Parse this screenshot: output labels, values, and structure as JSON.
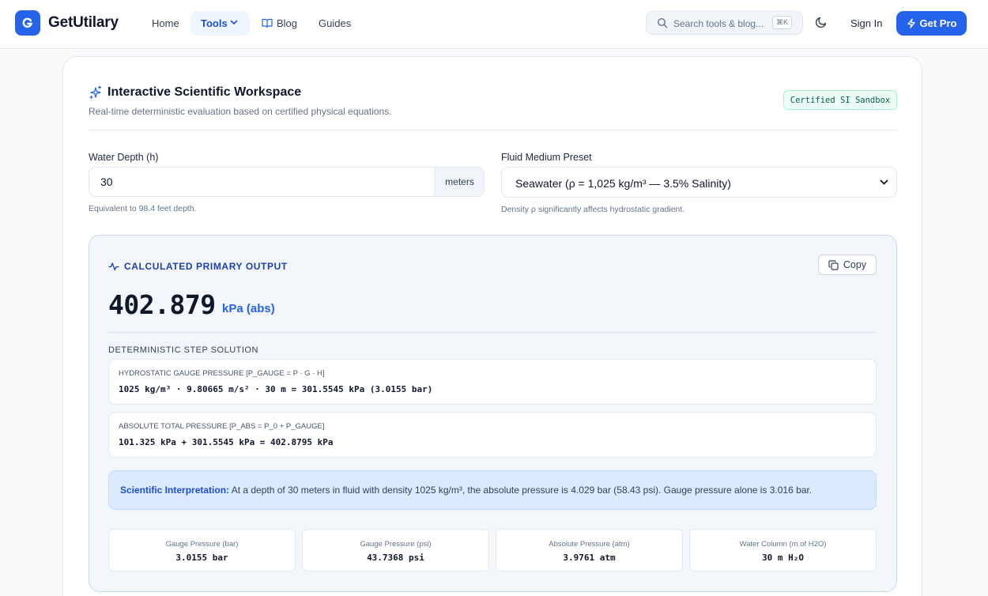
{
  "brand": {
    "logo_letter": "G",
    "name": "GetUtilary",
    "accent": "#2563eb"
  },
  "nav": {
    "home": "Home",
    "tools": "Tools",
    "blog": "Blog",
    "guides": "Guides",
    "search_placeholder": "Search tools & blog...",
    "search_shortcut": "⌘K",
    "sign_in": "Sign In",
    "get_pro": "Get Pro"
  },
  "workspace": {
    "title": "Interactive Scientific Workspace",
    "subtitle": "Real-time deterministic evaluation based on certified physical equations.",
    "badge": "Certified SI Sandbox"
  },
  "inputs": {
    "depth_label": "Water Depth (h)",
    "depth_value": "30",
    "depth_unit": "meters",
    "depth_hint": "Equivalent to 98.4 feet depth.",
    "medium_label": "Fluid Medium Preset",
    "medium_selected": "Seawater (ρ = 1,025 kg/m³ — 3.5% Salinity)",
    "medium_hint": "Density ρ significantly affects hydrostatic gradient."
  },
  "output": {
    "heading": "CALCULATED PRIMARY OUTPUT",
    "copy_label": "Copy",
    "value": "402.879",
    "unit": "kPa (abs)",
    "steps_title": "DETERMINISTIC STEP SOLUTION",
    "steps": [
      {
        "caption": "HYDROSTATIC GAUGE PRESSURE [P_GAUGE = P · G · H]",
        "equation": "1025 kg/m³ · 9.80665 m/s² · 30 m = 301.5545 kPa (3.0155 bar)"
      },
      {
        "caption": "ABSOLUTE TOTAL PRESSURE [P_ABS = P_0 + P_GAUGE]",
        "equation": "101.325 kPa + 301.5545 kPa = 402.8795 kPa"
      }
    ],
    "interpretation_label": "Scientific Interpretation:",
    "interpretation_text": "At a depth of 30 meters in fluid with density 1025 kg/m³, the absolute pressure is 4.029 bar (58.43 psi). Gauge pressure alone is 3.016 bar.",
    "metrics": [
      {
        "label": "Gauge Pressure (bar)",
        "value": "3.0155 bar"
      },
      {
        "label": "Gauge Pressure (psi)",
        "value": "43.7368 psi"
      },
      {
        "label": "Absolute Pressure (atm)",
        "value": "3.9761 atm"
      },
      {
        "label": "Water Column (m of H2O)",
        "value": "30 m H₂O"
      }
    ]
  }
}
